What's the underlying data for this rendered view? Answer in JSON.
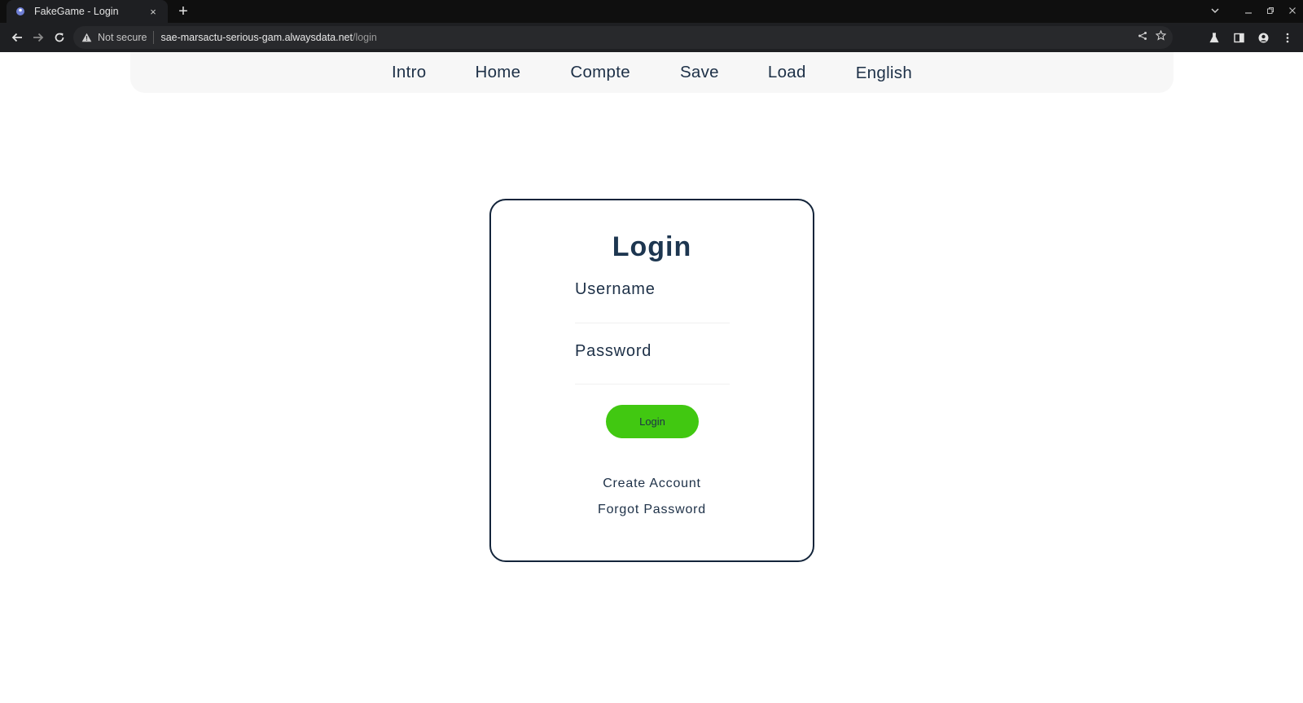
{
  "browser": {
    "tab_title": "FakeGame - Login",
    "tab_close": "×",
    "new_tab": "+",
    "security_label": "Not secure",
    "url_host": "sae-marsactu-serious-gam.alwaysdata.net",
    "url_path": "/login"
  },
  "nav": {
    "items": [
      "Intro",
      "Home",
      "Compte",
      "Save",
      "Load",
      "English"
    ]
  },
  "login": {
    "title": "Login",
    "username_label": "Username",
    "username_value": "",
    "password_label": "Password",
    "password_value": "",
    "submit_label": "Login",
    "create_account": "Create Account",
    "forgot_password": "Forgot Password"
  },
  "colors": {
    "accent_green": "#41c811",
    "text_navy": "#1d3047",
    "card_border": "#13243a"
  }
}
